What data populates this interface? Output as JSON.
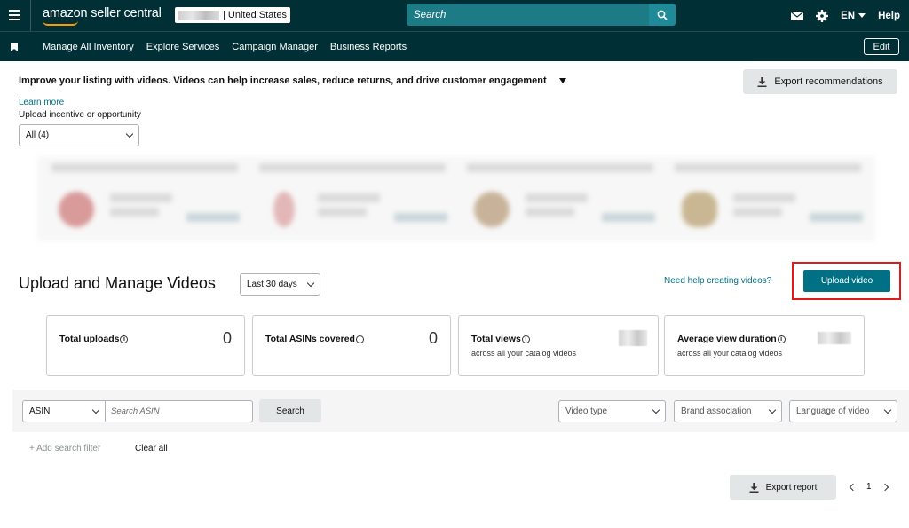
{
  "header": {
    "logo_text": "amazon seller central",
    "marketplace": "| United States",
    "search_placeholder": "Search",
    "language": "EN",
    "help": "Help"
  },
  "nav": {
    "items": [
      "Manage All Inventory",
      "Explore Services",
      "Campaign Manager",
      "Business Reports"
    ],
    "edit": "Edit"
  },
  "recommendations": {
    "headline": "Improve your listing with videos. Videos can help increase sales, reduce returns, and drive customer engagement",
    "export_label": "Export recommendations",
    "learn_more": "Learn more",
    "filter_label": "Upload incentive or opportunity",
    "filter_value": "All (4)"
  },
  "videos": {
    "title": "Upload and Manage Videos",
    "range": "Last 30 days",
    "help_link": "Need help creating videos?",
    "upload_button": "Upload video"
  },
  "kpis": [
    {
      "title": "Total uploads",
      "value": "0",
      "sub": ""
    },
    {
      "title": "Total ASINs covered",
      "value": "0",
      "sub": ""
    },
    {
      "title": "Total views",
      "value": "",
      "sub": "across all your catalog videos"
    },
    {
      "title": "Average view duration",
      "value": "",
      "sub": "across all your catalog videos"
    }
  ],
  "filters": {
    "asin_select": "ASIN",
    "search_placeholder": "Search ASIN",
    "search_button": "Search",
    "video_type": "Video type",
    "brand_association": "Brand association",
    "language_of_video": "Language of video",
    "add_filter": "+ Add search filter",
    "clear_all": "Clear all"
  },
  "footer": {
    "export_report": "Export report",
    "page": "1"
  }
}
